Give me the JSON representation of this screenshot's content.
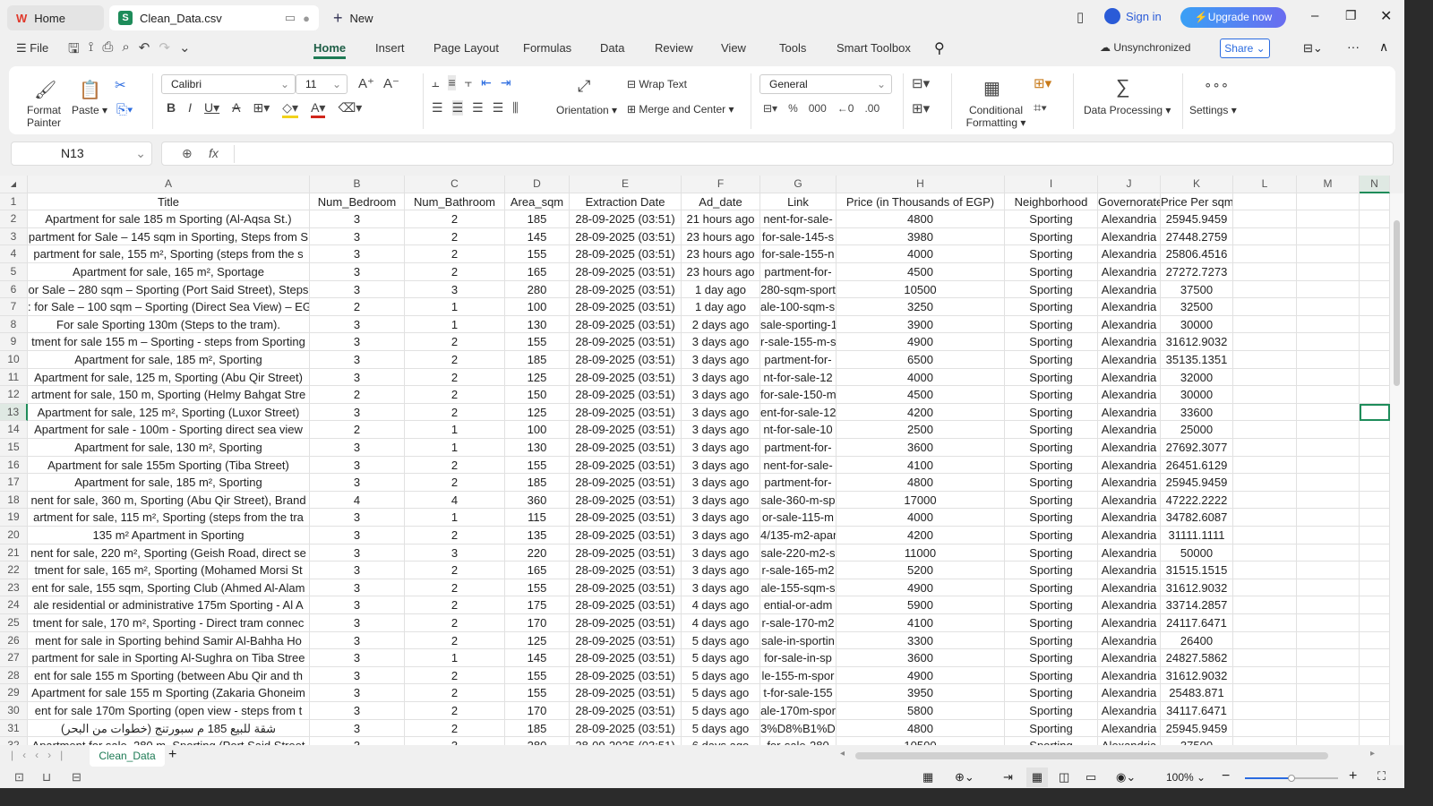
{
  "titlebar": {
    "home_tab": "Home",
    "file_tab": "Clean_Data.csv",
    "new_tab": "New",
    "sign_in": "Sign in",
    "upgrade": "Upgrade now"
  },
  "menu": {
    "file": "File",
    "tabs": [
      "Home",
      "Insert",
      "Page Layout",
      "Formulas",
      "Data",
      "Review",
      "View",
      "Tools",
      "Smart Toolbox"
    ],
    "active": "Home",
    "unsync": "Unsynchronized",
    "share": "Share"
  },
  "ribbon": {
    "format_painter": "Format Painter",
    "paste": "Paste",
    "font": "Calibri",
    "size": "11",
    "wrap": "Wrap Text",
    "merge": "Merge and Center",
    "orientation": "Orientation",
    "number_format": "General",
    "conditional": "Conditional Formatting",
    "data_processing": "Data Processing",
    "settings": "Settings"
  },
  "formula_bar": {
    "cell_ref": "N13",
    "fx": "fx",
    "value": ""
  },
  "columns": [
    "A",
    "B",
    "C",
    "D",
    "E",
    "F",
    "G",
    "H",
    "I",
    "J",
    "K",
    "L",
    "M",
    "N"
  ],
  "headers": [
    "Title",
    "Num_Bedroom",
    "Num_Bathroom",
    "Area_sqm",
    "Extraction Date",
    "Ad_date",
    "Link",
    "Price (in Thousands of EGP)",
    "Neighborhood",
    "Governorate",
    "Price Per sqm"
  ],
  "rows": [
    [
      "Apartment for sale 185 m Sporting (Al-Aqsa St.)",
      "3",
      "2",
      "185",
      "28-09-2025 (03:51)",
      "21 hours ago",
      "nent-for-sale-",
      "4800",
      "Sporting",
      "Alexandria",
      "25945.9459"
    ],
    [
      "partment for Sale – 145 sqm in Sporting, Steps from S",
      "3",
      "2",
      "145",
      "28-09-2025 (03:51)",
      "23 hours ago",
      "for-sale-145-s",
      "3980",
      "Sporting",
      "Alexandria",
      "27448.2759"
    ],
    [
      "partment for sale, 155 m², Sporting (steps from the s",
      "3",
      "2",
      "155",
      "28-09-2025 (03:51)",
      "23 hours ago",
      "for-sale-155-n",
      "4000",
      "Sporting",
      "Alexandria",
      "25806.4516"
    ],
    [
      "Apartment for sale, 165 m², Sportage",
      "3",
      "2",
      "165",
      "28-09-2025 (03:51)",
      "23 hours ago",
      "partment-for-",
      "4500",
      "Sporting",
      "Alexandria",
      "27272.7273"
    ],
    [
      "or Sale – 280 sqm – Sporting (Port Said Street), Steps",
      "3",
      "3",
      "280",
      "28-09-2025 (03:51)",
      "1 day ago",
      "280-sqm-sport",
      "10500",
      "Sporting",
      "Alexandria",
      "37500"
    ],
    [
      ": for Sale – 100 sqm – Sporting (Direct Sea View) – EGI",
      "2",
      "1",
      "100",
      "28-09-2025 (03:51)",
      "1 day ago",
      "ale-100-sqm-sp",
      "3250",
      "Sporting",
      "Alexandria",
      "32500"
    ],
    [
      "For sale Sporting 130m (Steps to the tram).",
      "3",
      "1",
      "130",
      "28-09-2025 (03:51)",
      "2 days ago",
      "sale-sporting-1",
      "3900",
      "Sporting",
      "Alexandria",
      "30000"
    ],
    [
      "tment for sale 155 m – Sporting - steps from Sporting",
      "3",
      "2",
      "155",
      "28-09-2025 (03:51)",
      "3 days ago",
      "r-sale-155-m-s",
      "4900",
      "Sporting",
      "Alexandria",
      "31612.9032"
    ],
    [
      "Apartment for sale, 185 m², Sporting",
      "3",
      "2",
      "185",
      "28-09-2025 (03:51)",
      "3 days ago",
      "partment-for-",
      "6500",
      "Sporting",
      "Alexandria",
      "35135.1351"
    ],
    [
      "Apartment for sale, 125 m, Sporting (Abu Qir Street)",
      "3",
      "2",
      "125",
      "28-09-2025 (03:51)",
      "3 days ago",
      "nt-for-sale-12",
      "4000",
      "Sporting",
      "Alexandria",
      "32000"
    ],
    [
      "artment for sale, 150 m, Sporting (Helmy Bahgat Stre",
      "2",
      "2",
      "150",
      "28-09-2025 (03:51)",
      "3 days ago",
      "for-sale-150-m",
      "4500",
      "Sporting",
      "Alexandria",
      "30000"
    ],
    [
      "Apartment for sale, 125 m², Sporting (Luxor Street)",
      "3",
      "2",
      "125",
      "28-09-2025 (03:51)",
      "3 days ago",
      "ent-for-sale-12",
      "4200",
      "Sporting",
      "Alexandria",
      "33600"
    ],
    [
      "Apartment for sale - 100m - Sporting direct sea view",
      "2",
      "1",
      "100",
      "28-09-2025 (03:51)",
      "3 days ago",
      "nt-for-sale-10",
      "2500",
      "Sporting",
      "Alexandria",
      "25000"
    ],
    [
      "Apartment for sale, 130 m², Sporting",
      "3",
      "1",
      "130",
      "28-09-2025 (03:51)",
      "3 days ago",
      "partment-for-",
      "3600",
      "Sporting",
      "Alexandria",
      "27692.3077"
    ],
    [
      "Apartment for sale 155m Sporting (Tiba Street)",
      "3",
      "2",
      "155",
      "28-09-2025 (03:51)",
      "3 days ago",
      "nent-for-sale-",
      "4100",
      "Sporting",
      "Alexandria",
      "26451.6129"
    ],
    [
      "Apartment for sale, 185 m², Sporting",
      "3",
      "2",
      "185",
      "28-09-2025 (03:51)",
      "3 days ago",
      "partment-for-",
      "4800",
      "Sporting",
      "Alexandria",
      "25945.9459"
    ],
    [
      "nent for sale, 360 m, Sporting (Abu Qir Street), Brand",
      "4",
      "4",
      "360",
      "28-09-2025 (03:51)",
      "3 days ago",
      "sale-360-m-sp",
      "17000",
      "Sporting",
      "Alexandria",
      "47222.2222"
    ],
    [
      "artment for sale, 115 m², Sporting (steps from the tra",
      "3",
      "1",
      "115",
      "28-09-2025 (03:51)",
      "3 days ago",
      "or-sale-115-m",
      "4000",
      "Sporting",
      "Alexandria",
      "34782.6087"
    ],
    [
      "135 m² Apartment in Sporting",
      "3",
      "2",
      "135",
      "28-09-2025 (03:51)",
      "3 days ago",
      "4/135-m2-apar",
      "4200",
      "Sporting",
      "Alexandria",
      "31111.1111"
    ],
    [
      "nent for sale, 220 m², Sporting (Geish Road, direct se",
      "3",
      "3",
      "220",
      "28-09-2025 (03:51)",
      "3 days ago",
      "sale-220-m2-s",
      "11000",
      "Sporting",
      "Alexandria",
      "50000"
    ],
    [
      "tment for sale, 165 m², Sporting (Mohamed Morsi St",
      "3",
      "2",
      "165",
      "28-09-2025 (03:51)",
      "3 days ago",
      "r-sale-165-m2",
      "5200",
      "Sporting",
      "Alexandria",
      "31515.1515"
    ],
    [
      "ent for sale, 155 sqm, Sporting Club (Ahmed Al-Alam",
      "3",
      "2",
      "155",
      "28-09-2025 (03:51)",
      "3 days ago",
      "ale-155-sqm-s",
      "4900",
      "Sporting",
      "Alexandria",
      "31612.9032"
    ],
    [
      "ale residential or administrative 175m Sporting - Al A",
      "3",
      "2",
      "175",
      "28-09-2025 (03:51)",
      "4 days ago",
      "ential-or-adm",
      "5900",
      "Sporting",
      "Alexandria",
      "33714.2857"
    ],
    [
      "tment for sale, 170 m², Sporting - Direct tram connec",
      "3",
      "2",
      "170",
      "28-09-2025 (03:51)",
      "4 days ago",
      "r-sale-170-m2",
      "4100",
      "Sporting",
      "Alexandria",
      "24117.6471"
    ],
    [
      "ment for sale in Sporting behind Samir Al-Bahha Ho",
      "3",
      "2",
      "125",
      "28-09-2025 (03:51)",
      "5 days ago",
      "sale-in-sportin",
      "3300",
      "Sporting",
      "Alexandria",
      "26400"
    ],
    [
      "partment for sale in Sporting Al-Sughra on Tiba Stree",
      "3",
      "1",
      "145",
      "28-09-2025 (03:51)",
      "5 days ago",
      "for-sale-in-sp",
      "3600",
      "Sporting",
      "Alexandria",
      "24827.5862"
    ],
    [
      "ent for sale 155 m Sporting (between Abu Qir and th",
      "3",
      "2",
      "155",
      "28-09-2025 (03:51)",
      "5 days ago",
      "le-155-m-spor",
      "4900",
      "Sporting",
      "Alexandria",
      "31612.9032"
    ],
    [
      "Apartment for sale 155 m Sporting (Zakaria Ghoneim",
      "3",
      "2",
      "155",
      "28-09-2025 (03:51)",
      "5 days ago",
      "t-for-sale-155",
      "3950",
      "Sporting",
      "Alexandria",
      "25483.871"
    ],
    [
      "ent for sale 170m Sporting (open view - steps from t",
      "3",
      "2",
      "170",
      "28-09-2025 (03:51)",
      "5 days ago",
      "ale-170m-spor",
      "5800",
      "Sporting",
      "Alexandria",
      "34117.6471"
    ],
    [
      "شقة للبيع 185 م سبورتنج (خطوات من البحر)",
      "3",
      "2",
      "185",
      "28-09-2025 (03:51)",
      "5 days ago",
      "3%D8%B1%D8",
      "4800",
      "Sporting",
      "Alexandria",
      "25945.9459"
    ],
    [
      "Apartment for sale, 280 m, Sporting (Port Said Street",
      "3",
      "3",
      "280",
      "28-09-2025 (03:51)",
      "6 days ago",
      "for-sale-280",
      "10500",
      "Sporting",
      "Alexandria",
      "37500"
    ]
  ],
  "sheet_tab": "Clean_Data",
  "status": {
    "zoom": "100%",
    "zoom_level": 0.5
  },
  "colors": {
    "accent": "#1e7b55",
    "upgrade": "#4a8cf0",
    "selection": "#1e8c5a"
  }
}
